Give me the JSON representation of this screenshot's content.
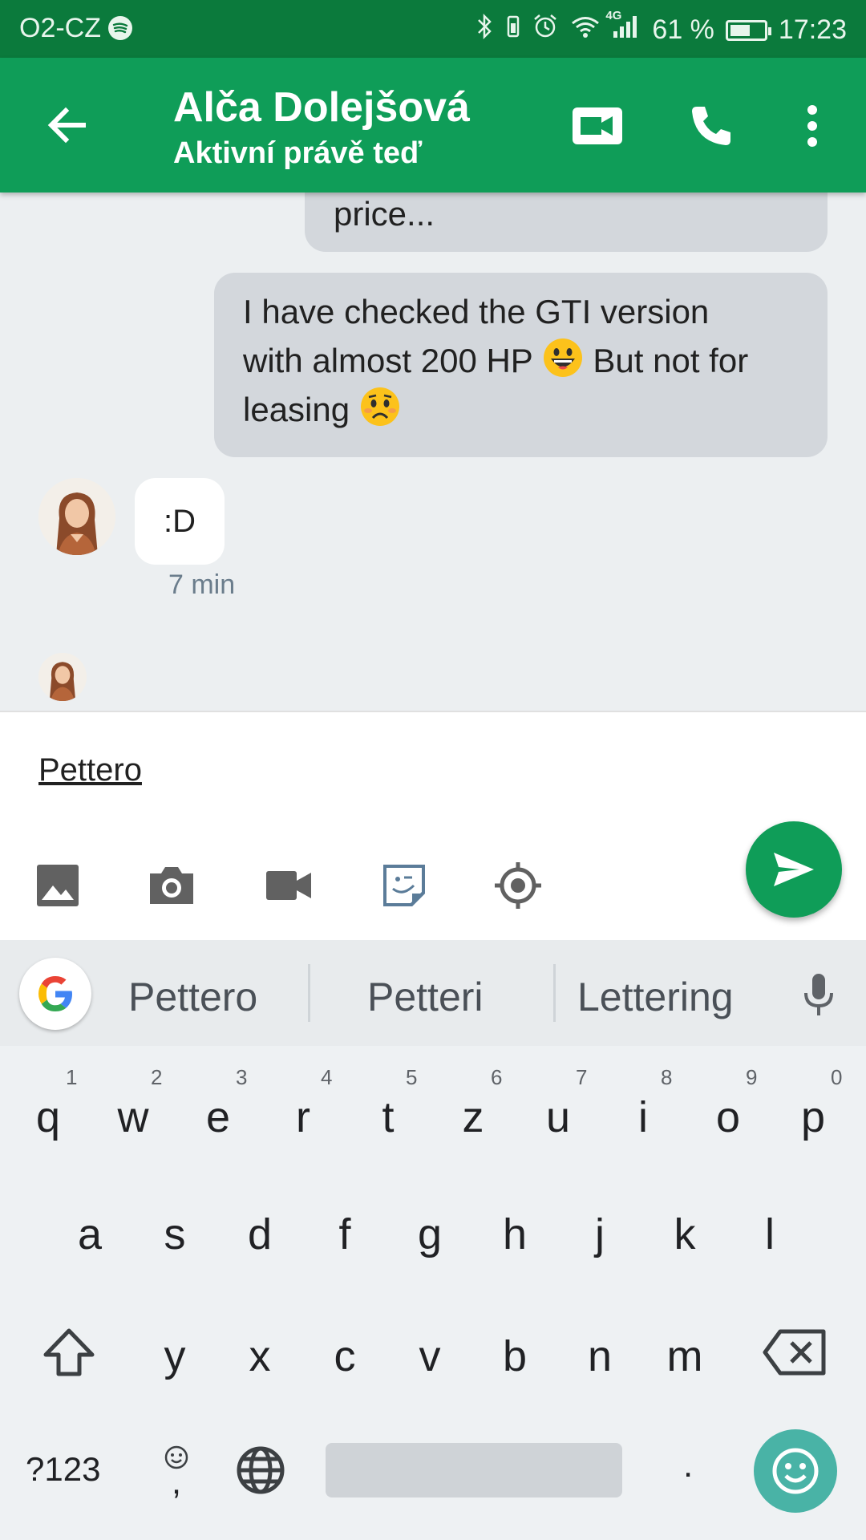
{
  "status_bar": {
    "carrier": "O2-CZ",
    "network": "4G",
    "battery": "61 %",
    "battery_level": 0.61,
    "time": "17:23"
  },
  "app_bar": {
    "contact_name": "Alča Dolejšová",
    "status": "Aktivní právě teď",
    "icons": [
      "back-arrow-icon",
      "video-call-icon",
      "phone-icon",
      "more-vert-icon"
    ]
  },
  "messages": [
    {
      "direction": "outgoing",
      "text": "price..."
    },
    {
      "direction": "outgoing",
      "lines": [
        "I have checked the GTI version",
        "with almost 200 HP",
        "But not for",
        "leasing"
      ],
      "emojis": [
        "grinning-face",
        "worried-face"
      ]
    },
    {
      "direction": "incoming",
      "text": ":D",
      "time": "7 min"
    }
  ],
  "compose": {
    "value": "Pettero",
    "tools": [
      "gallery-icon",
      "camera-icon",
      "video-icon",
      "sticker-icon",
      "location-icon"
    ],
    "send_icon": "send-icon"
  },
  "keyboard": {
    "suggestions": [
      "Pettero",
      "Petteri",
      "Lettering"
    ],
    "row1": [
      "q",
      "w",
      "e",
      "r",
      "t",
      "z",
      "u",
      "i",
      "o",
      "p"
    ],
    "row1_hints": [
      "1",
      "2",
      "3",
      "4",
      "5",
      "6",
      "7",
      "8",
      "9",
      "0"
    ],
    "row2": [
      "a",
      "s",
      "d",
      "f",
      "g",
      "h",
      "j",
      "k",
      "l"
    ],
    "row3": [
      "y",
      "x",
      "c",
      "v",
      "b",
      "n",
      "m"
    ],
    "symbols_key": "?123",
    "comma_key": ",",
    "period_key": "."
  },
  "colors": {
    "status_bar": "#0b7a3c",
    "app_bar": "#0f9d58",
    "outgoing_bubble": "#d3d7dc",
    "emoji_key": "#49b3a6"
  }
}
